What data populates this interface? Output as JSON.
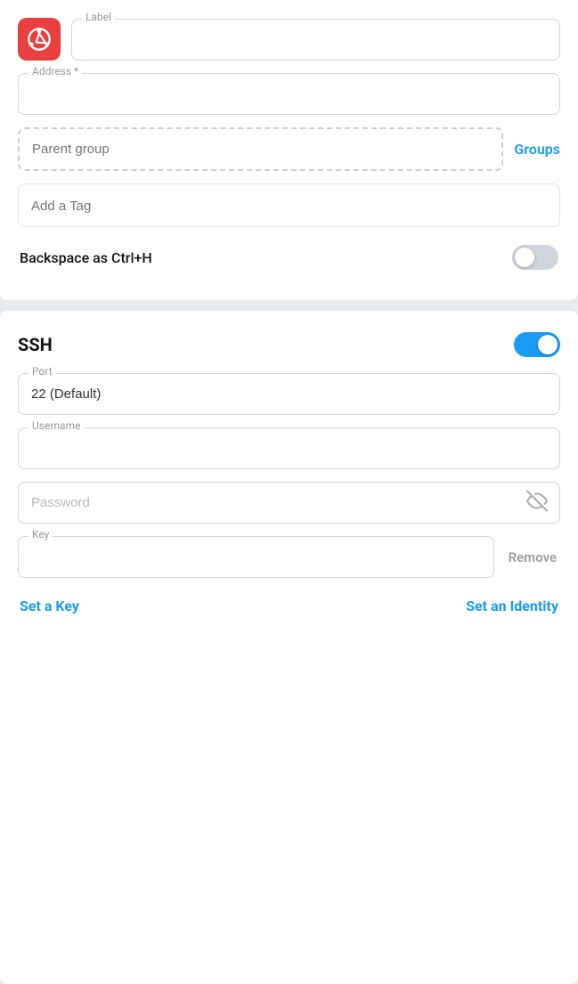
{
  "top_section": {
    "label_field": {
      "label": "Label",
      "placeholder": ""
    },
    "address_field": {
      "label": "Address *",
      "placeholder": ""
    },
    "parent_group": {
      "placeholder": "Parent group"
    },
    "groups_link": "Groups",
    "tag_placeholder": "Add a Tag",
    "backspace_label": "Backspace as Ctrl+H",
    "backspace_toggle_on": false
  },
  "ssh_section": {
    "title": "SSH",
    "ssh_enabled": true,
    "port_field": {
      "label": "Port",
      "value": "22 (Default)"
    },
    "username_field": {
      "label": "Username",
      "value": ""
    },
    "password_field": {
      "placeholder": "Password"
    },
    "key_field": {
      "label": "Key",
      "value": ""
    },
    "remove_label": "Remove",
    "set_key_label": "Set a Key",
    "set_identity_label": "Set an Identity"
  },
  "icons": {
    "app_icon": "ubuntu",
    "eye_off": "👁"
  }
}
